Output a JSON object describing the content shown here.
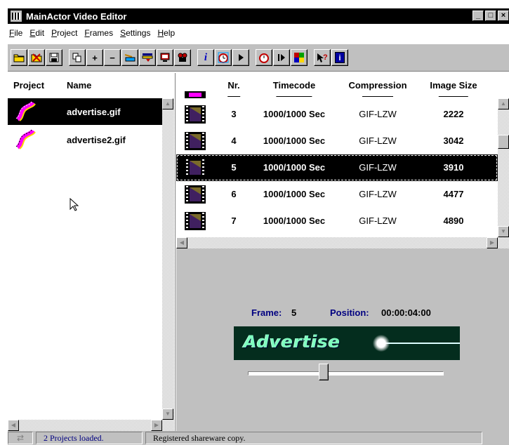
{
  "window": {
    "title": "MainActor Video Editor"
  },
  "menu": [
    "File",
    "Edit",
    "Project",
    "Frames",
    "Settings",
    "Help"
  ],
  "toolbar": {
    "info_glyph": "i",
    "blue_info_glyph": "i",
    "help_glyph": "?",
    "plus_glyph": "+",
    "minus_glyph": "−"
  },
  "projects": {
    "headers": {
      "project": "Project",
      "name": "Name"
    },
    "items": [
      {
        "name": "advertise.gif",
        "selected": true
      },
      {
        "name": "advertise2.gif",
        "selected": false
      }
    ]
  },
  "frames": {
    "headers": {
      "nr": "Nr.",
      "timecode": "Timecode",
      "compression": "Compression",
      "image_size": "Image Size"
    },
    "rows": [
      {
        "nr": "3",
        "timecode": "1000/1000 Sec",
        "compression": "GIF-LZW",
        "image_size": "2222",
        "selected": false
      },
      {
        "nr": "4",
        "timecode": "1000/1000 Sec",
        "compression": "GIF-LZW",
        "image_size": "3042",
        "selected": false
      },
      {
        "nr": "5",
        "timecode": "1000/1000 Sec",
        "compression": "GIF-LZW",
        "image_size": "3910",
        "selected": true
      },
      {
        "nr": "6",
        "timecode": "1000/1000 Sec",
        "compression": "GIF-LZW",
        "image_size": "4477",
        "selected": false
      },
      {
        "nr": "7",
        "timecode": "1000/1000 Sec",
        "compression": "GIF-LZW",
        "image_size": "4890",
        "selected": false
      }
    ]
  },
  "preview": {
    "frame_label": "Frame:",
    "frame_value": "5",
    "position_label": "Position:",
    "position_value": "00:00:04:00",
    "banner_text": "Advertise",
    "slider_fraction": 0.38
  },
  "status": {
    "projects_loaded": "2 Projects loaded.",
    "shareware": "Registered shareware copy."
  },
  "colors": {
    "title_bg": "#000000",
    "chrome": "#c0c0c0",
    "preview_label": "#000080",
    "banner_bg": "#042d1e"
  }
}
